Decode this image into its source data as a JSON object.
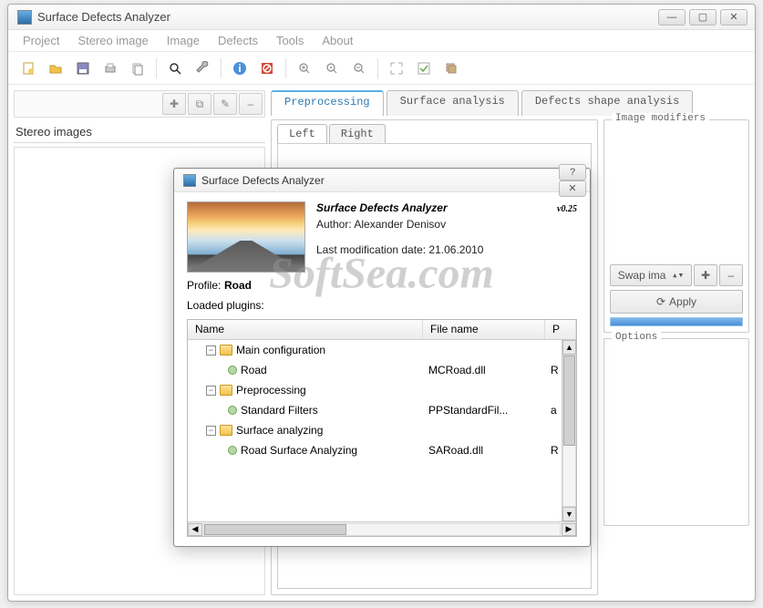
{
  "app": {
    "title": "Surface Defects Analyzer"
  },
  "menubar": [
    "Project",
    "Stereo image",
    "Image",
    "Defects",
    "Tools",
    "About"
  ],
  "left_panel": {
    "title": "Stereo images"
  },
  "tabs": {
    "main": [
      "Preprocessing",
      "Surface analysis",
      "Defects shape analysis"
    ],
    "main_active": 0,
    "sub": [
      "Left",
      "Right"
    ],
    "sub_active": 0
  },
  "side": {
    "modifiers_legend": "Image modifiers",
    "swap_label": "Swap ima",
    "apply_label": "Apply",
    "options_legend": "Options"
  },
  "dialog": {
    "title": "Surface Defects Analyzer",
    "name": "Surface Defects Analyzer",
    "version": "v0.25",
    "author_label": "Author:",
    "author": "Alexander Denisov",
    "moddate_label": "Last modification date:",
    "moddate": "21.06.2010",
    "profile_label": "Profile:",
    "profile_value": "Road",
    "loaded_label": "Loaded plugins:",
    "cols": {
      "name": "Name",
      "file": "File name",
      "p": "P"
    },
    "tree": [
      {
        "type": "group",
        "name": "Main configuration"
      },
      {
        "type": "leaf",
        "name": "Road",
        "file": "MCRoad.dll",
        "p": "R"
      },
      {
        "type": "group",
        "name": "Preprocessing"
      },
      {
        "type": "leaf",
        "name": "Standard Filters",
        "file": "PPStandardFil...",
        "p": "a"
      },
      {
        "type": "group",
        "name": "Surface analyzing"
      },
      {
        "type": "leaf",
        "name": "Road Surface Analyzing",
        "file": "SARoad.dll",
        "p": "R"
      }
    ]
  },
  "watermark": "SoftSea.com"
}
